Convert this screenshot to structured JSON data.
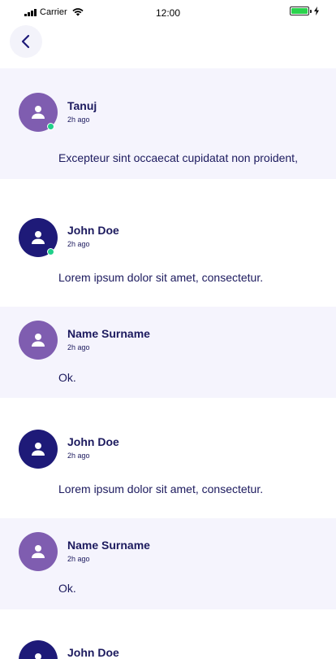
{
  "status_bar": {
    "carrier": "Carrier",
    "time": "12:00"
  },
  "colors": {
    "accent_light": "#7f5db0",
    "accent_dark": "#1e1a78",
    "online": "#20d08a",
    "shaded_row": "#f5f4fd",
    "text": "#1c1a5e"
  },
  "comments": [
    {
      "author": "Tanuj",
      "time": "2h ago",
      "text": "Excepteur sint occaecat cupidatat non proident,",
      "avatar": "user-icon",
      "online": true
    },
    {
      "author": "John Doe",
      "time": "2h ago",
      "text": "Lorem ipsum dolor sit amet, consectetur.",
      "avatar": "user-icon",
      "online": true
    },
    {
      "author": "Name Surname",
      "time": "2h ago",
      "text": "Ok.",
      "avatar": "user-icon",
      "online": false
    },
    {
      "author": "John Doe",
      "time": "2h ago",
      "text": "Lorem ipsum dolor sit amet, consectetur.",
      "avatar": "user-icon",
      "online": false
    },
    {
      "author": "Name Surname",
      "time": "2h ago",
      "text": "Ok.",
      "avatar": "user-icon",
      "online": false
    },
    {
      "author": "John Doe",
      "time": "",
      "text": "",
      "avatar": "user-icon",
      "online": false
    }
  ]
}
